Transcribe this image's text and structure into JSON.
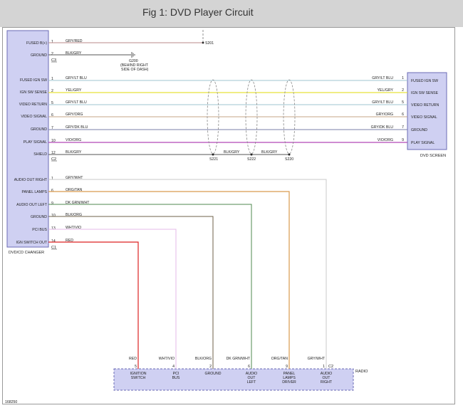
{
  "title": "Fig 1: DVD Player Circuit",
  "figure_number": "168250",
  "colors": {
    "box_fill": "#cfd0f2",
    "box_border": "#6b6bb5",
    "GRY/RED": "#b98a8a",
    "BLK/GRY": "#555555",
    "GRY/LT BLU": "#9fc4d2",
    "YEL/GRY": "#e8e23a",
    "GRY/ORG": "#c4a486",
    "GRY/DK BLU": "#7a7fa8",
    "VIO/ORG": "#b247b8",
    "GRY/WHT": "#c9c9c9",
    "ORG/TAN": "#d99a4e",
    "DK GRN/WHT": "#4f8a4f",
    "BLK/ORG": "#6f6048",
    "WHT/VIO": "#e5b8e8",
    "RED": "#dd2222"
  },
  "dvd_changer": {
    "name": "DVD/CD CHANGER",
    "connectors": [
      "C3",
      "C2",
      "C1"
    ],
    "pins": [
      {
        "label": "FUSED B(+)",
        "pin": "1",
        "wire": "GRY/RED"
      },
      {
        "label": "GROUND",
        "pin": "2",
        "wire": "BLK/GRY"
      },
      {
        "label": "FUSED IGN SW",
        "pin": "1",
        "wire": "GRY/LT BLU"
      },
      {
        "label": "IGN SW SENSE",
        "pin": "2",
        "wire": "YEL/GRY"
      },
      {
        "label": "VIDEO RETURN",
        "pin": "5",
        "wire": "GRY/LT BLU"
      },
      {
        "label": "VIDEO SIGNAL",
        "pin": "6",
        "wire": "GRY/ORG"
      },
      {
        "label": "GROUND",
        "pin": "7",
        "wire": "GRY/DK BLU"
      },
      {
        "label": "PLAY SIGNAL",
        "pin": "10",
        "wire": "VIO/ORG"
      },
      {
        "label": "SHIELD",
        "pin": "12",
        "wire": "BLK/GRY"
      },
      {
        "label": "AUDIO OUT RIGHT",
        "pin": "1",
        "wire": "GRY/WHT"
      },
      {
        "label": "PANEL LAMPS",
        "pin": "6",
        "wire": "ORG/TAN"
      },
      {
        "label": "AUDIO OUT LEFT",
        "pin": "9",
        "wire": "DK GRN/WHT"
      },
      {
        "label": "GROUND",
        "pin": "10",
        "wire": "BLK/ORG"
      },
      {
        "label": "PCI BUS",
        "pin": "13",
        "wire": "WHT/VIO"
      },
      {
        "label": "IGN SWITCH OUT",
        "pin": "14",
        "wire": "RED"
      }
    ]
  },
  "dvd_screen": {
    "name": "DVD SCREEN",
    "pins": [
      {
        "label": "FUSED IGN SW",
        "pin": "1",
        "wire": "GRY/LT BLU"
      },
      {
        "label": "IGN SW SENSE",
        "pin": "2",
        "wire": "YEL/GRY"
      },
      {
        "label": "VIDEO RETURN",
        "pin": "5",
        "wire": "GRY/LT BLU"
      },
      {
        "label": "VIDEO SIGNAL",
        "pin": "6",
        "wire": "GRY/ORG"
      },
      {
        "label": "GROUND",
        "pin": "7",
        "wire": "GRY/DK BLU"
      },
      {
        "label": "PLAY SIGNAL",
        "pin": "9",
        "wire": "VIO/ORG"
      }
    ]
  },
  "radio": {
    "name": "RADIO",
    "connector": "C2",
    "pins": [
      {
        "label": "IGNITION SWITCH",
        "pin": "5",
        "wire": "RED"
      },
      {
        "label": "PCI BUS",
        "pin": "4",
        "wire": "WHT/VIO"
      },
      {
        "label": "GROUND",
        "pin": "2",
        "wire": "BLK/ORG"
      },
      {
        "label": "AUDIO OUT LEFT",
        "pin": "6",
        "wire": "DK GRN/WHT"
      },
      {
        "label": "PANEL LAMPS DRIVER",
        "pin": "9",
        "wire": "ORG/TAN"
      },
      {
        "label": "AUDIO OUT RIGHT",
        "pin": "1",
        "wire": "GRY/WHT"
      }
    ]
  },
  "splices": {
    "s201": "S201",
    "s221": "S221",
    "s222": "S222",
    "s220": "S220",
    "shield_between_1": "BLK/GRY",
    "shield_between_2": "BLK/GRY"
  },
  "ground_point": {
    "id": "G200",
    "line1": "(BEHIND RIGHT",
    "line2": "SIDE OF DASH)"
  }
}
